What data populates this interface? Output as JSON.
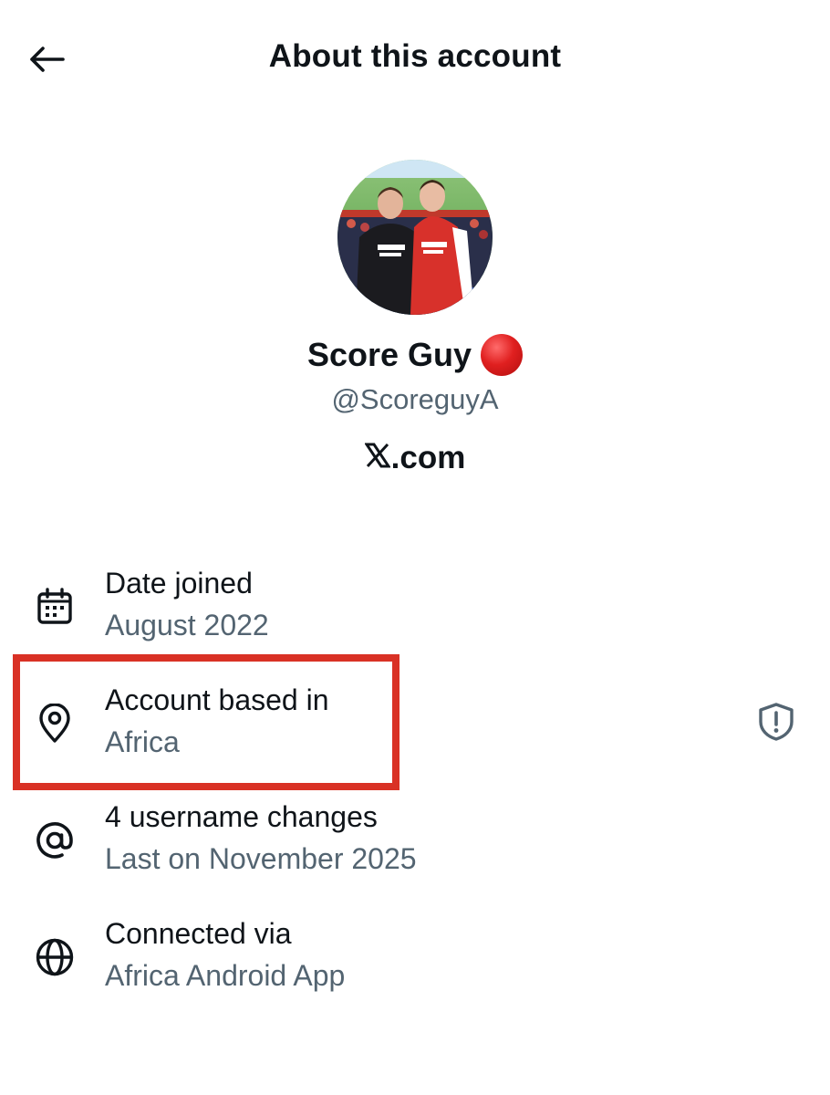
{
  "header": {
    "title": "About this account",
    "back_icon": "arrow-left-icon"
  },
  "profile": {
    "avatar_icon": "profile-photo",
    "display_name": "Score Guy",
    "status_emoji": "red-circle",
    "handle": "@ScoreguyA",
    "site": ".com",
    "site_logo_icon": "x-logo-icon"
  },
  "details": [
    {
      "icon": "calendar-icon",
      "title": "Date joined",
      "value": "August 2022"
    },
    {
      "icon": "location-pin-icon",
      "title": "Account based in",
      "value": "Africa"
    },
    {
      "icon": "at-sign-icon",
      "title": "4 username changes",
      "value": "Last on November 2025"
    },
    {
      "icon": "globe-icon",
      "title": "Connected via",
      "value": "Africa Android App"
    }
  ],
  "colors": {
    "text_primary": "#0f1419",
    "text_secondary": "#536471",
    "highlight_border": "#d93125",
    "status_dot": "#e02020"
  }
}
